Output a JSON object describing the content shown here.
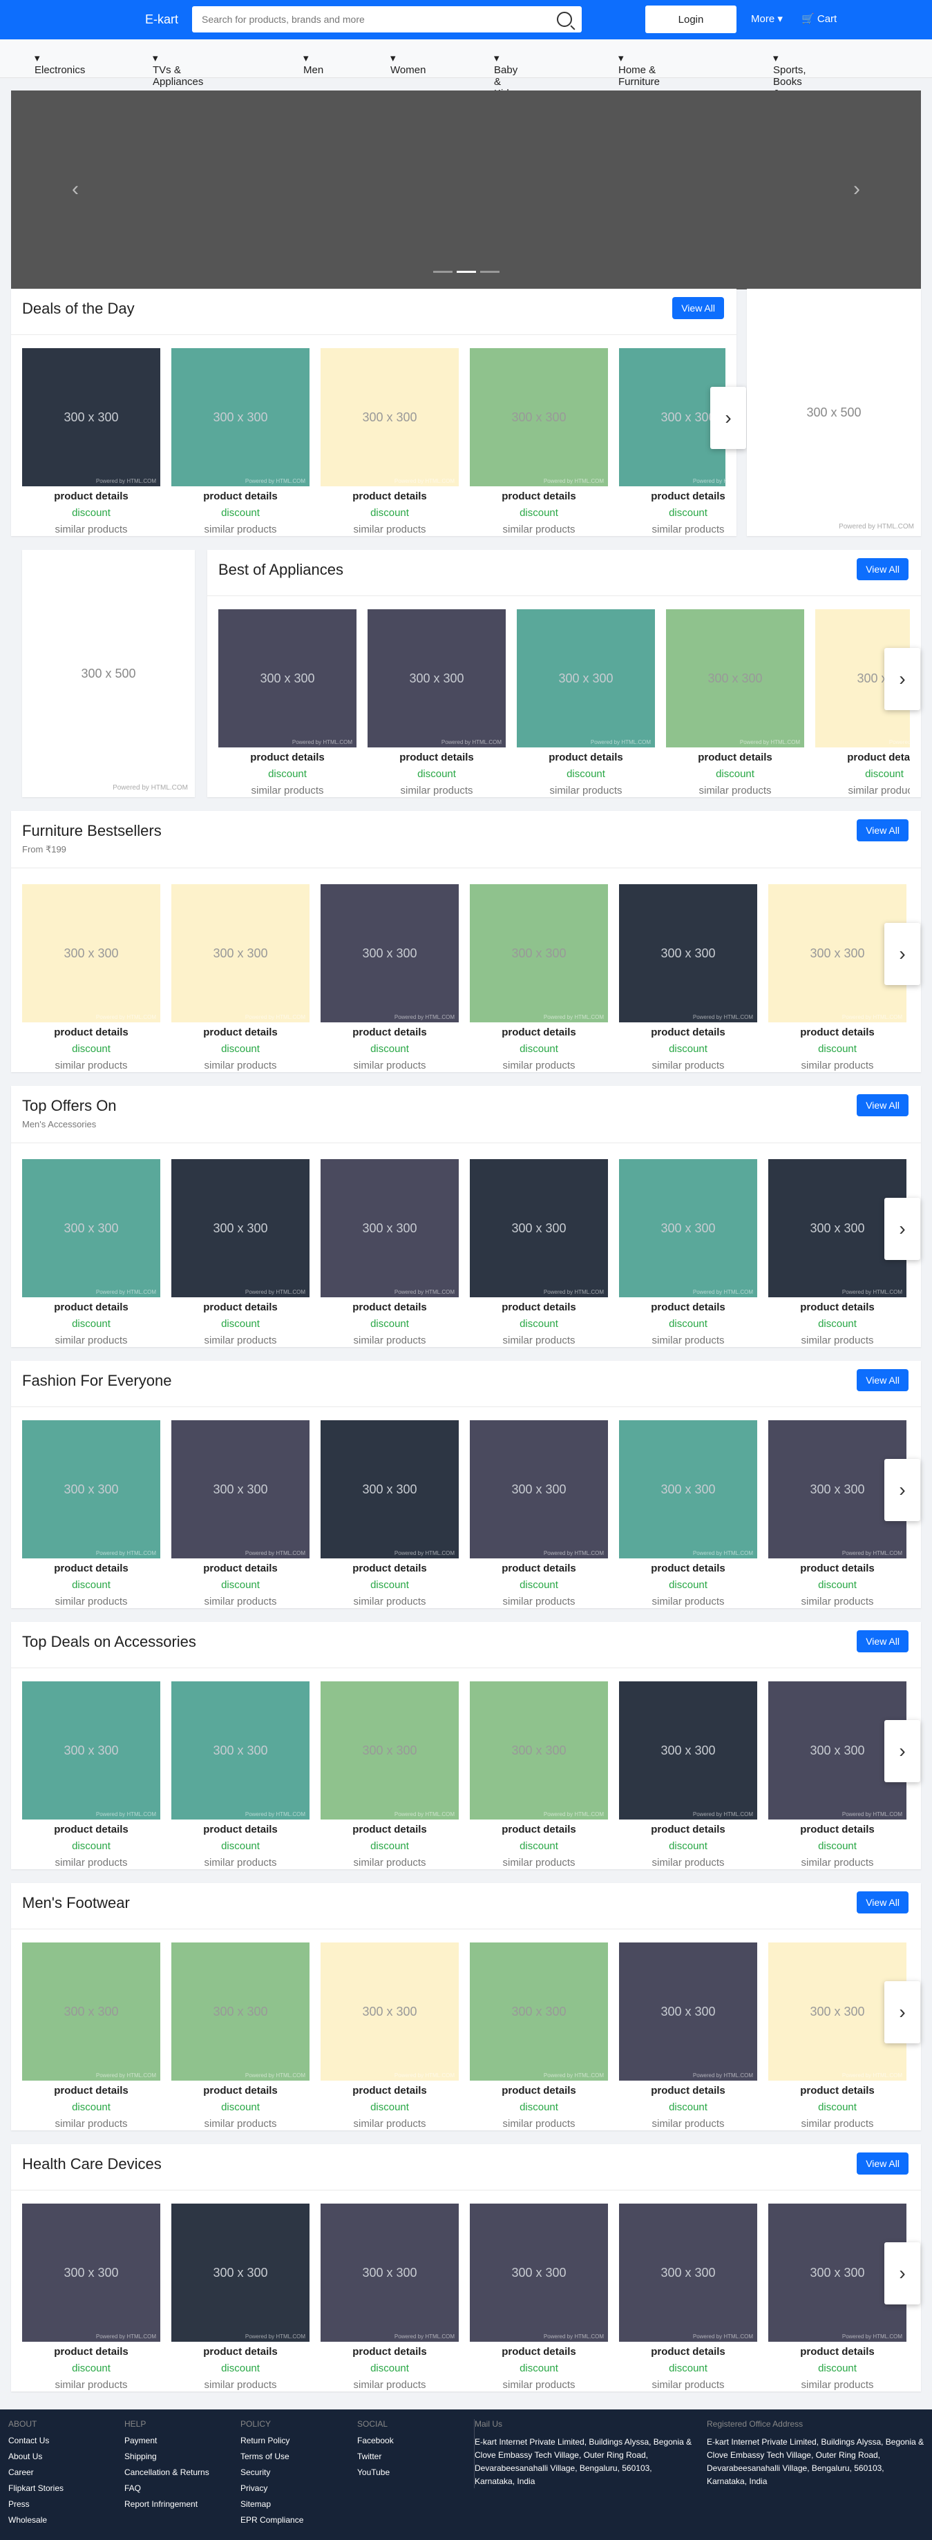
{
  "header": {
    "brand": "E-kart",
    "search_placeholder": "Search for products, brands and more",
    "login": "Login",
    "more": "More",
    "cart": "Cart"
  },
  "nav": [
    "Electronics",
    "TVs & Appliances",
    "Men",
    "Women",
    "Baby & Kids",
    "Home & Furniture",
    "Sports, Books & More"
  ],
  "placeholder": "300 x 300",
  "powered": "Powered by HTML.COM",
  "banner": {
    "text": "300 x 500",
    "powered": "Powered by HTML.COM"
  },
  "product": {
    "details": "product details",
    "discount": "discount",
    "similar": "similar products"
  },
  "view_all": "View All",
  "colors": {
    "dark": "#2d3644",
    "slate": "#4a4a5e",
    "teal": "#5aa89a",
    "green": "#8fc28d",
    "cream": "#fdf2cb",
    "accent": "#0d6efd"
  },
  "sections": [
    {
      "title": "Deals of the Day",
      "subtitle": "",
      "tiles": [
        "dark",
        "teal",
        "cream",
        "green",
        "teal"
      ]
    },
    {
      "title": "Best of Appliances",
      "subtitle": "",
      "tiles": [
        "slate",
        "slate",
        "teal",
        "green",
        "cream"
      ]
    },
    {
      "title": "Furniture Bestsellers",
      "subtitle": "From ₹199",
      "tiles": [
        "cream",
        "cream",
        "slate",
        "green",
        "dark",
        "cream"
      ]
    },
    {
      "title": "Top Offers On",
      "subtitle": "Men's Accessories",
      "tiles": [
        "teal",
        "dark",
        "slate",
        "dark",
        "teal",
        "dark"
      ]
    },
    {
      "title": "Fashion For Everyone",
      "subtitle": "",
      "tiles": [
        "teal",
        "slate",
        "dark",
        "slate",
        "teal",
        "slate"
      ]
    },
    {
      "title": "Top Deals on Accessories",
      "subtitle": "",
      "tiles": [
        "teal",
        "teal",
        "green",
        "green",
        "dark",
        "slate"
      ]
    },
    {
      "title": "Men's Footwear",
      "subtitle": "",
      "tiles": [
        "green",
        "green",
        "cream",
        "green",
        "slate",
        "cream"
      ]
    },
    {
      "title": "Health Care Devices",
      "subtitle": "",
      "tiles": [
        "slate",
        "dark",
        "slate",
        "slate",
        "slate",
        "slate"
      ]
    }
  ],
  "footer": {
    "about": {
      "head": "ABOUT",
      "items": [
        "Contact Us",
        "About Us",
        "Career",
        "Flipkart Stories",
        "Press",
        "Wholesale"
      ]
    },
    "help": {
      "head": "HELP",
      "items": [
        "Payment",
        "Shipping",
        "Cancellation & Returns",
        "FAQ",
        "Report Infringement"
      ]
    },
    "policy": {
      "head": "POLICY",
      "items": [
        "Return Policy",
        "Terms of Use",
        "Security",
        "Privacy",
        "Sitemap",
        "EPR Compliance"
      ]
    },
    "social": {
      "head": "SOCIAL",
      "items": [
        "Facebook",
        "Twitter",
        "YouTube"
      ]
    },
    "mail": {
      "head": "Mail Us",
      "text": "E-kart Internet Private Limited, Buildings Alyssa, Begonia & Clove Embassy Tech Village, Outer Ring Road, Devarabeesanahalli Village, Bengaluru, 560103, Karnataka, India"
    },
    "office": {
      "head": "Registered Office Address",
      "text": "E-kart Internet Private Limited, Buildings Alyssa, Begonia & Clove Embassy Tech Village, Outer Ring Road, Devarabeesanahalli Village, Bengaluru, 560103, Karnataka, India"
    }
  }
}
